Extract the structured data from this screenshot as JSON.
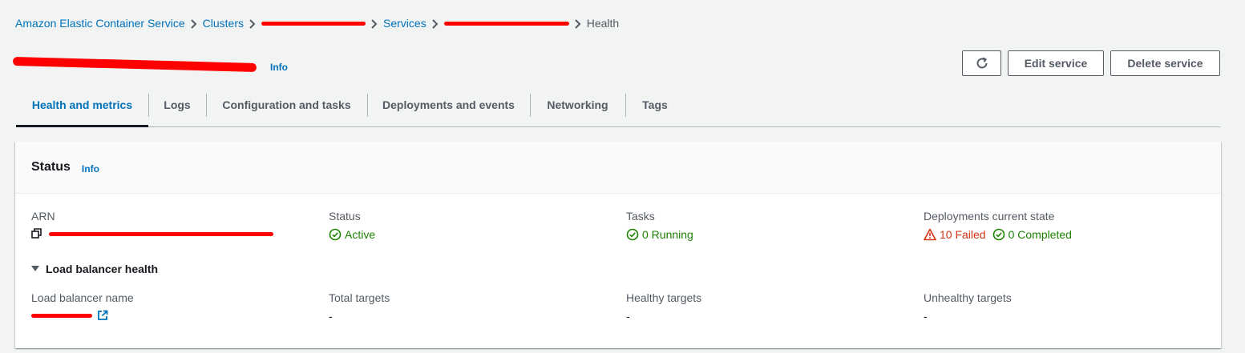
{
  "breadcrumb": {
    "root": "Amazon Elastic Container Service",
    "clusters": "Clusters",
    "services": "Services",
    "current": "Health"
  },
  "header": {
    "info": "Info",
    "refresh_icon": "refresh-icon",
    "edit_label": "Edit service",
    "delete_label": "Delete service"
  },
  "tabs": [
    {
      "label": "Health and metrics",
      "active": true
    },
    {
      "label": "Logs"
    },
    {
      "label": "Configuration and tasks"
    },
    {
      "label": "Deployments and events"
    },
    {
      "label": "Networking"
    },
    {
      "label": "Tags"
    }
  ],
  "status_panel": {
    "title": "Status",
    "info": "Info",
    "arn_label": "ARN",
    "status_label": "Status",
    "status_value": "Active",
    "tasks_label": "Tasks",
    "tasks_value": "0 Running",
    "deployments_label": "Deployments current state",
    "deployments_failed": "10 Failed",
    "deployments_completed": "0 Completed"
  },
  "load_balancer": {
    "toggle_label": "Load balancer health",
    "name_label": "Load balancer name",
    "total_label": "Total targets",
    "total_value": "-",
    "healthy_label": "Healthy targets",
    "healthy_value": "-",
    "unhealthy_label": "Unhealthy targets",
    "unhealthy_value": "-"
  },
  "colors": {
    "link": "#0073bb",
    "success": "#1d8102",
    "error": "#d13212",
    "redaction": "#ff0000"
  }
}
